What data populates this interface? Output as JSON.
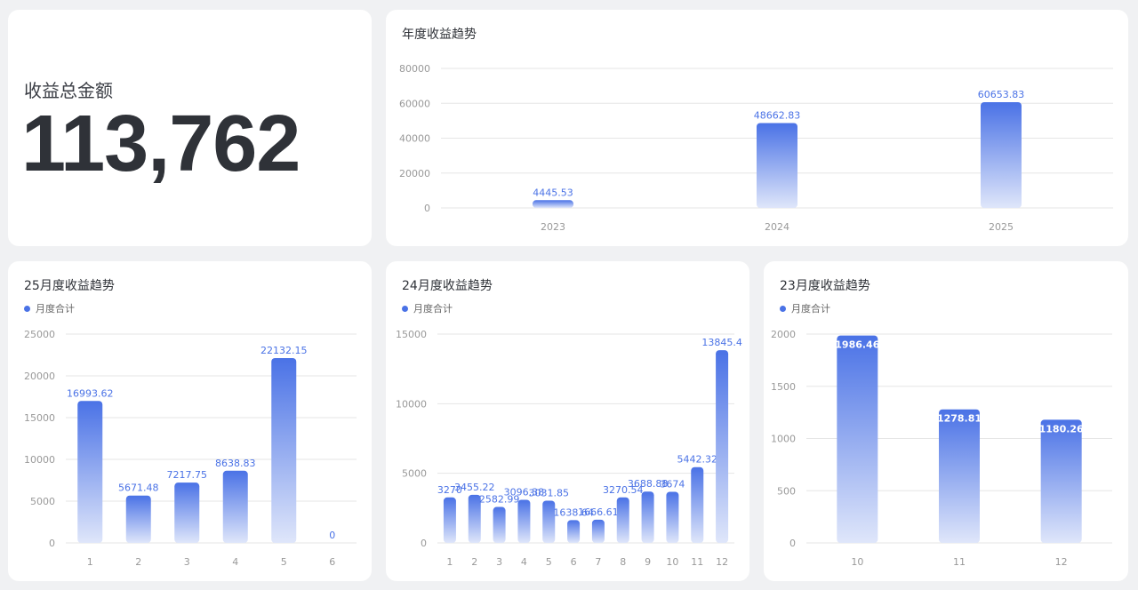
{
  "total": {
    "label": "收益总金额",
    "value": "113,762"
  },
  "colors": {
    "bar_top": "#4a72e6",
    "bar_bottom": "#dfe6fa",
    "value_label": "#4a72e6",
    "axis_text": "#999999",
    "grid": "#e6e6e6"
  },
  "chart_data": [
    {
      "id": "annual",
      "type": "bar",
      "title": "年度收益趋势",
      "legend": "",
      "categories": [
        "2023",
        "2024",
        "2025"
      ],
      "values": [
        4445.53,
        48662.83,
        60653.83
      ],
      "value_labels": [
        "4445.53",
        "48662.83",
        "60653.83"
      ],
      "ylim": [
        0,
        80000
      ],
      "yticks": [
        "0",
        "20000",
        "40000",
        "60000",
        "80000"
      ],
      "label_position": "above",
      "grid": true
    },
    {
      "id": "m25",
      "type": "bar",
      "title": "25月度收益趋势",
      "legend": "月度合计",
      "categories": [
        "1",
        "2",
        "3",
        "4",
        "5",
        "6"
      ],
      "values": [
        16993.62,
        5671.48,
        7217.75,
        8638.83,
        22132.15,
        0
      ],
      "value_labels": [
        "16993.62",
        "5671.48",
        "7217.75",
        "8638.83",
        "22132.15",
        "0"
      ],
      "ylim": [
        0,
        25000
      ],
      "yticks": [
        "0",
        "5000",
        "10000",
        "15000",
        "20000",
        "25000"
      ],
      "label_position": "above",
      "grid": true
    },
    {
      "id": "m24",
      "type": "bar",
      "title": "24月度收益趋势",
      "legend": "月度合计",
      "categories": [
        "1",
        "2",
        "3",
        "4",
        "5",
        "6",
        "7",
        "8",
        "9",
        "10",
        "11",
        "12"
      ],
      "values": [
        3270,
        3455.22,
        2582.99,
        3096.38,
        3031.85,
        1638.64,
        1666.61,
        3270.54,
        3688.88,
        3674,
        5442.32,
        13845.4
      ],
      "value_labels": [
        "3270",
        "3455.22",
        "2582.99",
        "3096.38",
        "3031.85",
        "1638.64",
        "1666.61",
        "3270.54",
        "3688.88",
        "3674",
        "5442.32",
        "13845.4"
      ],
      "ylim": [
        0,
        15000
      ],
      "yticks": [
        "0",
        "5000",
        "10000",
        "15000"
      ],
      "label_position": "above",
      "grid": true
    },
    {
      "id": "m23",
      "type": "bar",
      "title": "23月度收益趋势",
      "legend": "月度合计",
      "categories": [
        "10",
        "11",
        "12"
      ],
      "values": [
        1986.46,
        1278.81,
        1180.26
      ],
      "value_labels": [
        "1986.46",
        "1278.81",
        "1180.26"
      ],
      "ylim": [
        0,
        2000
      ],
      "yticks": [
        "0",
        "500",
        "1000",
        "1500",
        "2000"
      ],
      "label_position": "inside-top",
      "grid": true
    }
  ]
}
